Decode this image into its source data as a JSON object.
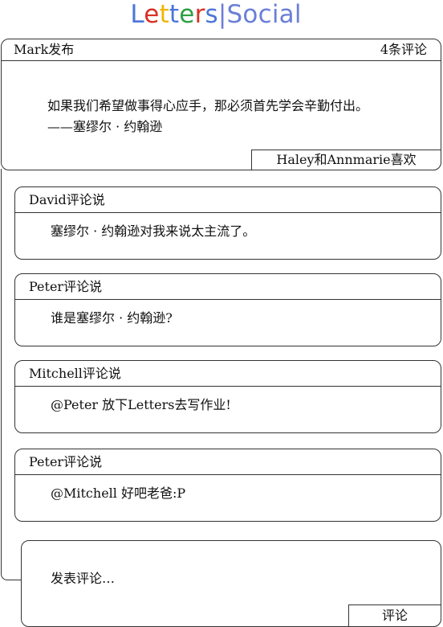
{
  "logo": {
    "letters": [
      {
        "ch": "L",
        "color": "#4a76d8"
      },
      {
        "ch": "e",
        "color": "#d93025"
      },
      {
        "ch": "t",
        "color": "#f2b400"
      },
      {
        "ch": "t",
        "color": "#4a76d8"
      },
      {
        "ch": "e",
        "color": "#2e9e45"
      },
      {
        "ch": "r",
        "color": "#d93025"
      },
      {
        "ch": "s",
        "color": "#4a76d8"
      }
    ],
    "separator": "|",
    "suffix": "Social"
  },
  "post": {
    "author_line": "Mark发布",
    "comment_count": "4条评论",
    "quote_line": "如果我们希望做事得心应手，那必须首先学会辛勤付出。",
    "attribution": "——塞缪尔 · 约翰逊",
    "likes": "Haley和Annmarie喜欢"
  },
  "comments": [
    {
      "header": "David评论说",
      "body": "塞缪尔 · 约翰逊对我来说太主流了。"
    },
    {
      "header": "Peter评论说",
      "body": "谁是塞缪尔 · 约翰逊?"
    },
    {
      "header": "Mitchell评论说",
      "body": "@Peter 放下Letters去写作业!"
    },
    {
      "header": "Peter评论说",
      "body": "@Mitchell 好吧老爸:P"
    }
  ],
  "composer": {
    "placeholder": "发表评论…",
    "submit_label": "评论"
  }
}
